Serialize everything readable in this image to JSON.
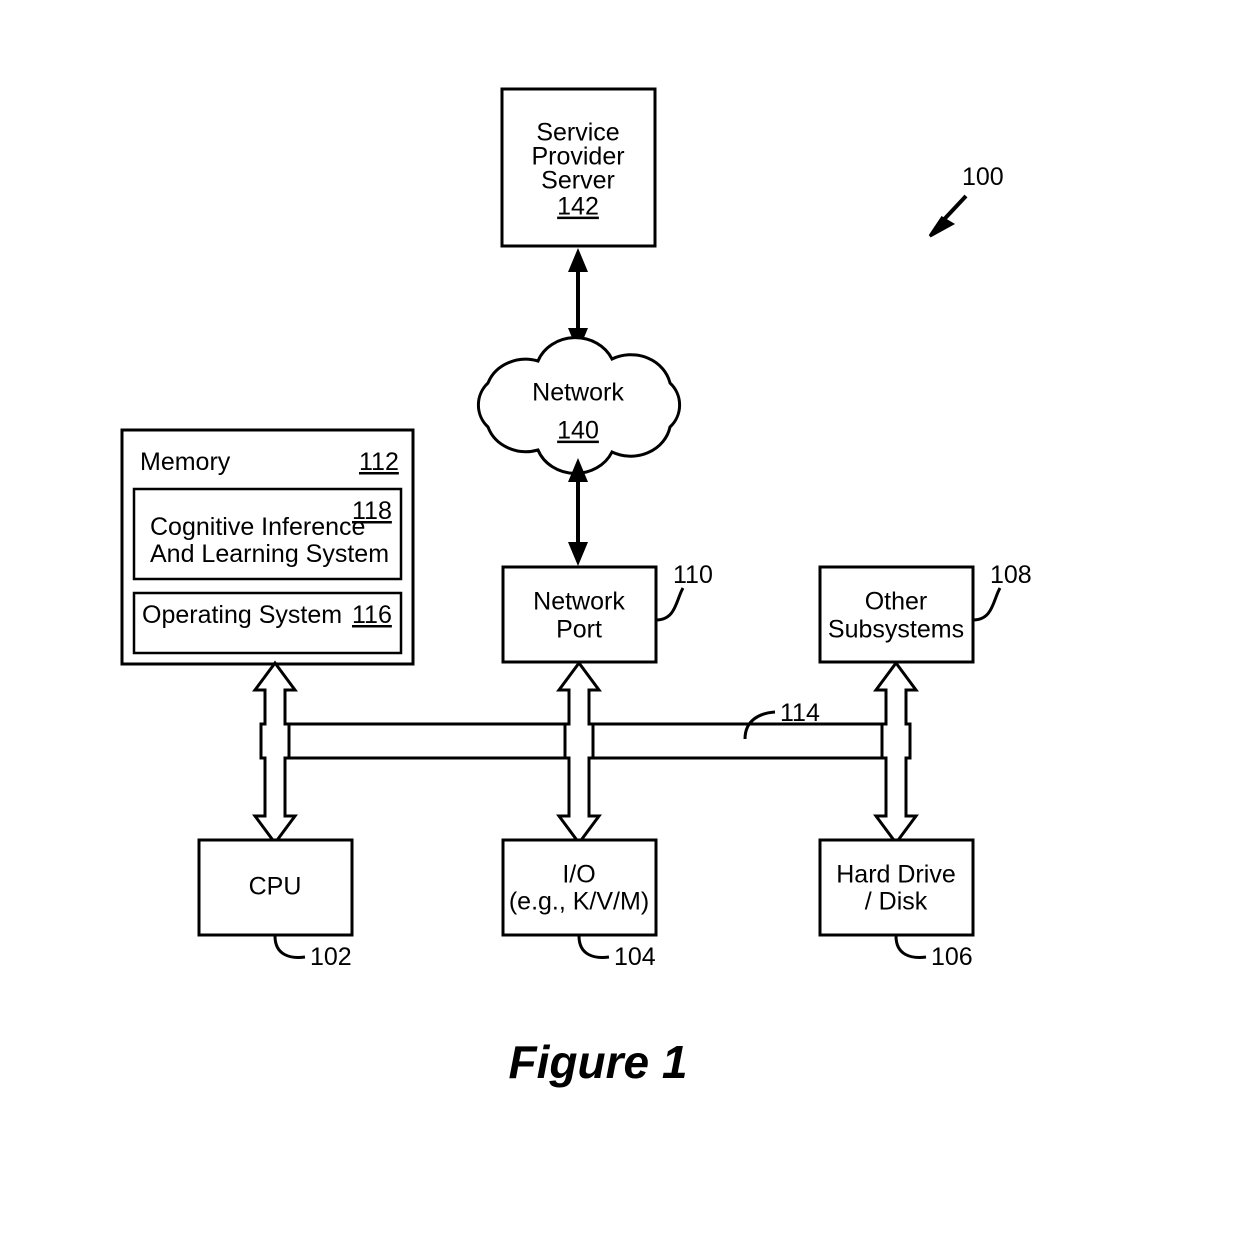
{
  "figure": {
    "caption": "Figure 1",
    "system_ref": "100"
  },
  "nodes": {
    "service_provider_server": {
      "line1": "Service",
      "line2": "Provider",
      "line3": "Server",
      "ref": "142"
    },
    "network_cloud": {
      "label": "Network",
      "ref": "140"
    },
    "memory": {
      "label": "Memory",
      "ref": "112"
    },
    "cognitive_system": {
      "line1": "Cognitive Inference",
      "line2": "And Learning System",
      "ref": "118"
    },
    "operating_system": {
      "label": "Operating System",
      "ref": "116"
    },
    "network_port": {
      "line1": "Network",
      "line2": "Port",
      "ref": "110"
    },
    "other_subsystems": {
      "line1": "Other",
      "line2": "Subsystems",
      "ref": "108"
    },
    "cpu": {
      "label": "CPU",
      "ref": "102"
    },
    "io": {
      "line1": "I/O",
      "line2": "(e.g., K/V/M)",
      "ref": "104"
    },
    "hard_drive": {
      "line1": "Hard Drive",
      "line2": "/ Disk",
      "ref": "106"
    },
    "bus": {
      "ref": "114"
    }
  },
  "colors": {
    "stroke": "#000000",
    "fill": "#ffffff",
    "background": "#ffffff"
  }
}
